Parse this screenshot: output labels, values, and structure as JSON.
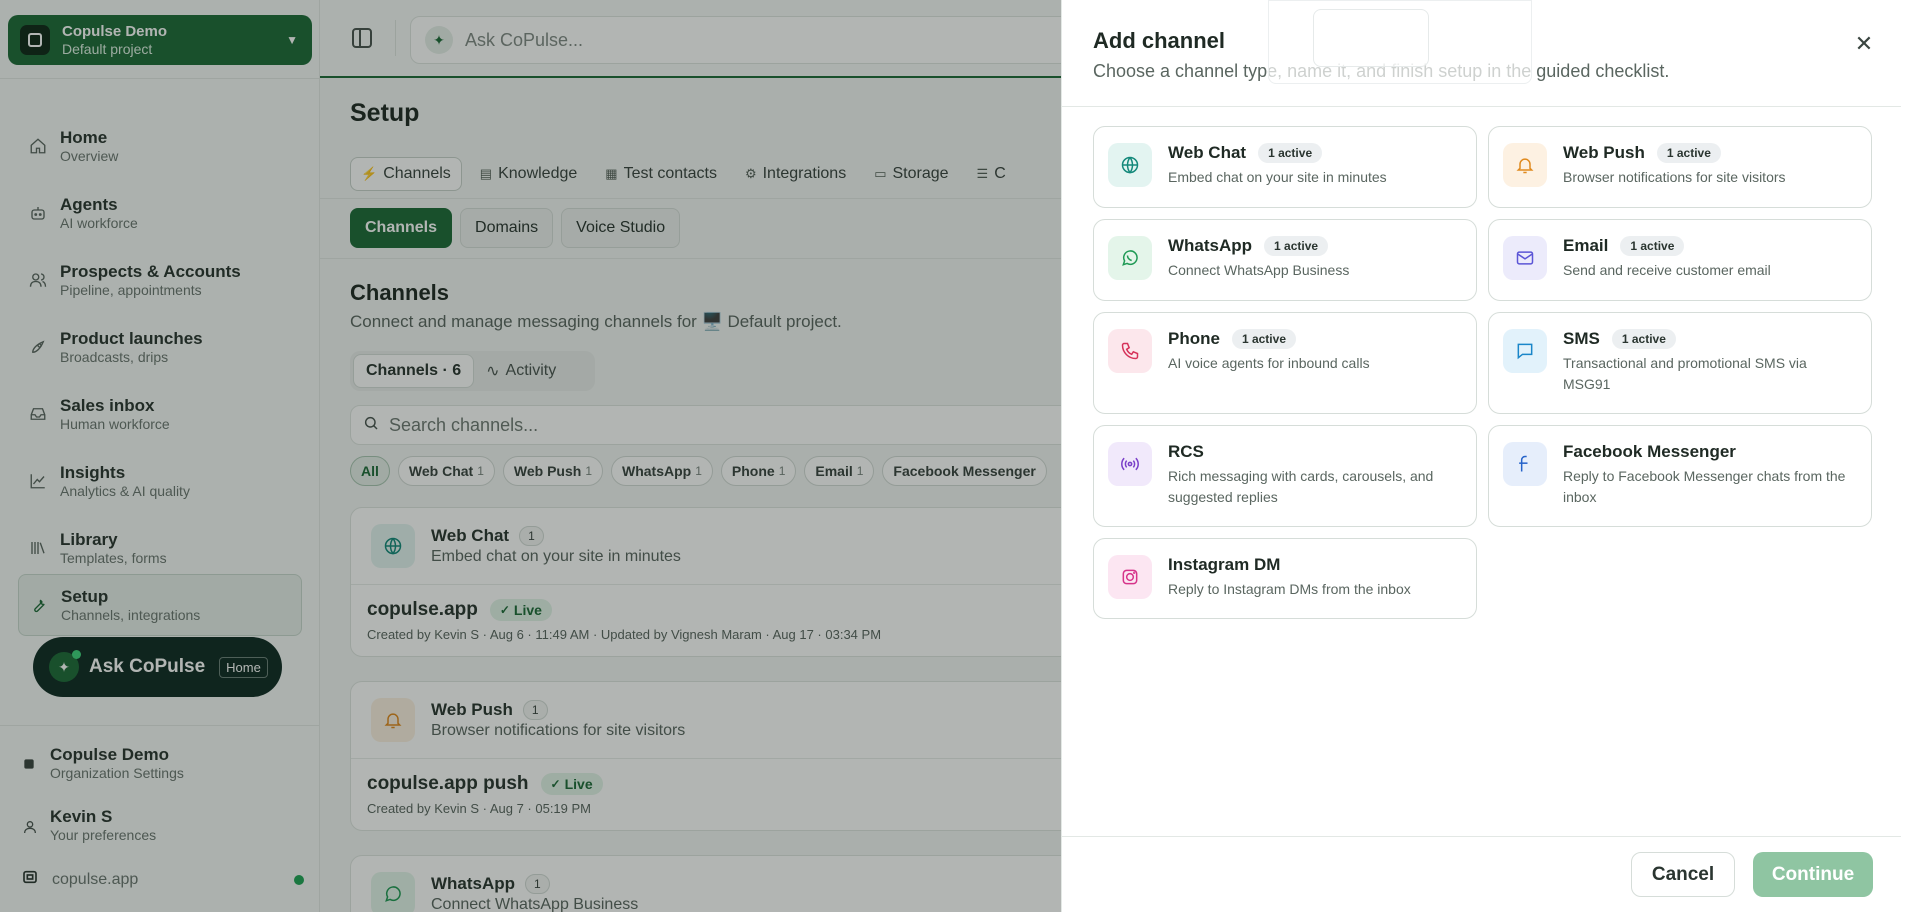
{
  "org": {
    "name": "Copulse Demo",
    "project": "Default project"
  },
  "sidebar": {
    "items": [
      {
        "title": "Home",
        "sub": "Overview",
        "icon": "home-icon"
      },
      {
        "title": "Agents",
        "sub": "AI workforce",
        "icon": "bot-icon"
      },
      {
        "title": "Prospects & Accounts",
        "sub": "Pipeline, appointments",
        "icon": "users-icon"
      },
      {
        "title": "Product launches",
        "sub": "Broadcasts, drips",
        "icon": "rocket-icon"
      },
      {
        "title": "Sales inbox",
        "sub": "Human workforce",
        "icon": "inbox-icon"
      },
      {
        "title": "Insights",
        "sub": "Analytics & AI quality",
        "icon": "chart-icon"
      },
      {
        "title": "Library",
        "sub": "Templates, forms",
        "icon": "library-icon"
      },
      {
        "title": "Setup",
        "sub": "Channels, integrations",
        "icon": "wrench-icon"
      }
    ],
    "ask": {
      "label": "Ask CoPulse",
      "badge": "Home"
    },
    "footer": {
      "org": {
        "title": "Copulse Demo",
        "sub": "Organization Settings"
      },
      "user": {
        "title": "Kevin S",
        "sub": "Your preferences"
      },
      "domain": "copulse.app"
    }
  },
  "topbar": {
    "ask_placeholder": "Ask CoPulse..."
  },
  "page": {
    "title": "Setup",
    "tabs": [
      {
        "label": "Channels",
        "icon": "plug-icon"
      },
      {
        "label": "Knowledge",
        "icon": "book-icon"
      },
      {
        "label": "Test contacts",
        "icon": "contact-icon"
      },
      {
        "label": "Integrations",
        "icon": "puzzle-icon"
      },
      {
        "label": "Storage",
        "icon": "drive-icon"
      },
      {
        "label": "C",
        "icon": "sliders-icon"
      }
    ],
    "subtabs": [
      "Channels",
      "Domains",
      "Voice Studio"
    ],
    "section": {
      "title": "Channels",
      "subtitle": "Connect and manage messaging channels for 🖥️ Default project."
    },
    "view_tabs": [
      "Channels · 6",
      "Activity"
    ],
    "search_placeholder": "Search channels...",
    "filters": [
      {
        "label": "All",
        "count": ""
      },
      {
        "label": "Web Chat",
        "count": "1"
      },
      {
        "label": "Web Push",
        "count": "1"
      },
      {
        "label": "WhatsApp",
        "count": "1"
      },
      {
        "label": "Phone",
        "count": "1"
      },
      {
        "label": "Email",
        "count": "1"
      },
      {
        "label": "Facebook Messenger",
        "count": ""
      }
    ],
    "channels": [
      {
        "name": "Web Chat",
        "count": "1",
        "desc": "Embed chat on your site in minutes",
        "host": "copulse.app",
        "status": "Live",
        "meta": "Created by Kevin S · Aug 6 · 11:49 AM · Updated by Vignesh Maram · Aug 17 · 03:34 PM"
      },
      {
        "name": "Web Push",
        "count": "1",
        "desc": "Browser notifications for site visitors",
        "host": "copulse.app push",
        "status": "Live",
        "meta": "Created by Kevin S · Aug 7 · 05:19 PM"
      },
      {
        "name": "WhatsApp",
        "count": "1",
        "desc": "Connect WhatsApp Business"
      }
    ]
  },
  "drawer": {
    "title": "Add channel",
    "subtitle": "Choose a channel type, name it, and finish setup in the guided checklist.",
    "options": [
      {
        "name": "Web Chat",
        "badge": "1 active",
        "desc": "Embed chat on your site in minutes",
        "icon": "globe-icon",
        "color": "#14897b",
        "bg": "#e3f4f1"
      },
      {
        "name": "Web Push",
        "badge": "1 active",
        "desc": "Browser notifications for site visitors",
        "icon": "bell-icon",
        "color": "#e08a1e",
        "bg": "#fdf1e2"
      },
      {
        "name": "WhatsApp",
        "badge": "1 active",
        "desc": "Connect WhatsApp Business",
        "icon": "whatsapp-icon",
        "color": "#1f9a55",
        "bg": "#e4f5ea"
      },
      {
        "name": "Email",
        "badge": "1 active",
        "desc": "Send and receive customer email",
        "icon": "mail-icon",
        "color": "#5b55d6",
        "bg": "#ecebfb"
      },
      {
        "name": "Phone",
        "badge": "1 active",
        "desc": "AI voice agents for inbound calls",
        "icon": "phone-icon",
        "color": "#d6335a",
        "bg": "#fce7ec"
      },
      {
        "name": "SMS",
        "badge": "1 active",
        "desc": "Transactional and promotional SMS via MSG91",
        "icon": "message-icon",
        "color": "#1a86c9",
        "bg": "#e2f2fb"
      },
      {
        "name": "RCS",
        "badge": "",
        "desc": "Rich messaging with cards, carousels, and suggested replies",
        "icon": "broadcast-icon",
        "color": "#7a3fc9",
        "bg": "#f1e9fb"
      },
      {
        "name": "Facebook Messenger",
        "badge": "",
        "desc": "Reply to Facebook Messenger chats from the inbox",
        "icon": "facebook-icon",
        "color": "#2563c9",
        "bg": "#e6eefb"
      },
      {
        "name": "Instagram DM",
        "badge": "",
        "desc": "Reply to Instagram DMs from the inbox",
        "icon": "instagram-icon",
        "color": "#d6338a",
        "bg": "#fce6f2"
      }
    ],
    "cancel": "Cancel",
    "continue": "Continue"
  }
}
